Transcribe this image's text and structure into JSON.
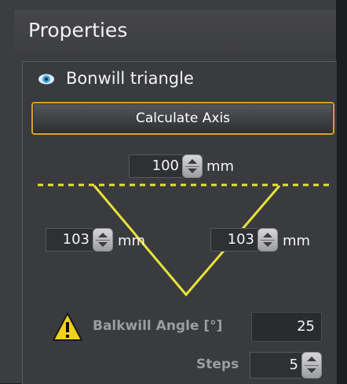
{
  "panel": {
    "title": "Properties"
  },
  "group": {
    "title": "Bonwill triangle",
    "visibility_icon": "eye-icon",
    "calculate_label": "Calculate Axis"
  },
  "triangle": {
    "top": {
      "value": "100",
      "unit": "mm"
    },
    "left": {
      "value": "103",
      "unit": "mm"
    },
    "right": {
      "value": "103",
      "unit": "mm"
    },
    "line_color": "#e8e23a"
  },
  "balkwill": {
    "warning_icon": "warning-icon",
    "label": "Balkwill Angle [°]",
    "value": "25"
  },
  "steps": {
    "label": "Steps",
    "value": "5"
  },
  "colors": {
    "accent": "#d8a22c",
    "triangle": "#e8e23a",
    "eye": "#4aa8e0"
  }
}
